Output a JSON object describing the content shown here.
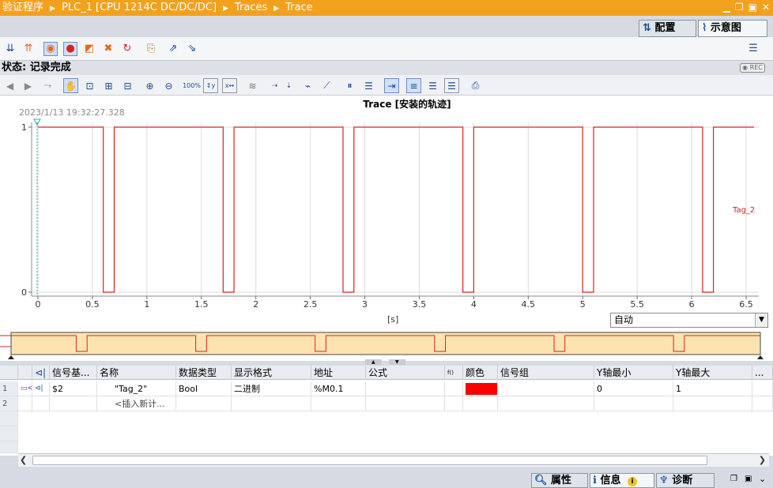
{
  "titlebar": {
    "crumbs": [
      "验证程序",
      "PLC_1 [CPU 1214C DC/DC/DC]",
      "Traces",
      "Trace"
    ],
    "window_controls": [
      "minimize-icon",
      "restore-icon",
      "maximize-icon",
      "close-icon"
    ]
  },
  "view_tabs": {
    "config_label": "配置",
    "diagram_label": "示意图",
    "active": "示意图"
  },
  "status": {
    "text": "状态: 记录完成",
    "rec_label": "REC"
  },
  "chart": {
    "title": "Trace [安装的轨迹]",
    "timestamp": "2023/1/13 19:32:27.328",
    "series_label": "Tag_2",
    "x_unit": "[s]",
    "x_ticks": [
      "0",
      "0.5",
      "1",
      "1.5",
      "2",
      "2.5",
      "3",
      "3.5",
      "4",
      "4.5",
      "5",
      "5.5",
      "6",
      "6.5"
    ],
    "y_ticks": [
      "1",
      "0"
    ],
    "scale_mode": "自动"
  },
  "chart_data": {
    "type": "line",
    "xlabel": "[s]",
    "ylabel": "",
    "xlim": [
      0,
      6.5
    ],
    "ylim": [
      0,
      1
    ],
    "step": true,
    "grid": true,
    "series": [
      {
        "name": "Tag_2",
        "color": "#d9231f",
        "x": [
          0.0,
          0.6,
          0.6,
          0.7,
          0.7,
          1.7,
          1.7,
          1.8,
          1.8,
          2.8,
          2.8,
          2.9,
          2.9,
          3.9,
          3.9,
          4.0,
          4.0,
          5.0,
          5.0,
          5.1,
          5.1,
          6.1,
          6.1,
          6.2,
          6.2,
          6.5
        ],
        "y": [
          1,
          1,
          0,
          0,
          1,
          1,
          0,
          0,
          1,
          1,
          0,
          0,
          1,
          1,
          0,
          0,
          1,
          1,
          0,
          0,
          1,
          1,
          0,
          0,
          1,
          1
        ]
      }
    ]
  },
  "table": {
    "headers": [
      "信号基...",
      "名称",
      "数据类型",
      "显示格式",
      "地址",
      "公式",
      "颜色",
      "信号组",
      "Y轴最小",
      "Y轴最大"
    ],
    "rows": [
      {
        "num": "1",
        "base": "$2",
        "name": "\"Tag_2\"",
        "type": "Bool",
        "format": "二进制",
        "address": "%M0.1",
        "formula": "",
        "color": "#ff0000",
        "group": "",
        "ymin": "0",
        "ymax": "1"
      },
      {
        "num": "2",
        "base": "",
        "name": "<插入新计...",
        "type": "",
        "format": "",
        "address": "",
        "formula": "",
        "color": "",
        "group": "",
        "ymin": "",
        "ymax": ""
      }
    ]
  },
  "bottom_tabs": {
    "properties": "属性",
    "info": "信息",
    "diagnostics": "诊断"
  }
}
